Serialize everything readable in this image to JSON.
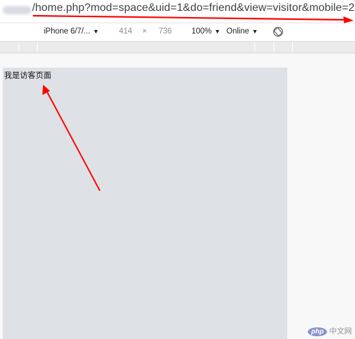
{
  "address_bar": {
    "url": "/home.php?mod=space&uid=1&do=friend&view=visitor&mobile=2"
  },
  "device_toolbar": {
    "device": "iPhone 6/7/...",
    "width": "414",
    "times": "×",
    "height": "736",
    "zoom": "100%",
    "network": "Online",
    "caret": "▼"
  },
  "viewport": {
    "text": "我是访客页面"
  },
  "watermark": {
    "logo": "php",
    "site": "中文网"
  },
  "colors": {
    "annotation_red": "#ff0000",
    "viewport_bg": "#dee1e6"
  }
}
